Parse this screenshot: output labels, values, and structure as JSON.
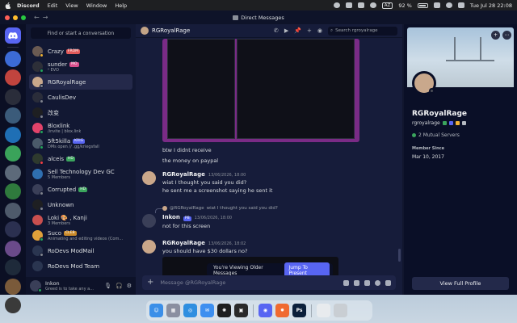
{
  "menubar": {
    "app_name": "Discord",
    "menus": [
      "Edit",
      "View",
      "Window",
      "Help"
    ],
    "input_source": "AZ",
    "battery": "92 %",
    "clock": "Tue Jul 28  22:08"
  },
  "window": {
    "title": "Direct Messages"
  },
  "rail": {
    "servers": [
      {
        "color": "#3c6bd6"
      },
      {
        "color": "#c1443e"
      },
      {
        "color": "#2a2d3a"
      },
      {
        "color": "#3b5b7a"
      },
      {
        "color": "#1f6fb5"
      },
      {
        "color": "#3aa35a"
      },
      {
        "color": "#5d6a7a"
      },
      {
        "color": "#2f7a3d"
      },
      {
        "color": "#4e5a6b"
      },
      {
        "color": "#2b3050"
      },
      {
        "color": "#6a4a8a"
      },
      {
        "color": "#1e2a3a"
      },
      {
        "color": "#7a5a3a"
      },
      {
        "color": "#3a3a3a"
      }
    ]
  },
  "sidebar": {
    "search_placeholder": "Find or start a conversation",
    "dms": [
      {
        "name": "Crazy",
        "tag": "FROM",
        "tag_color": "#e05a5a",
        "sub": "",
        "avatar": "#6a5a52",
        "status": "#f0b232"
      },
      {
        "name": "sunder",
        "tag": "MO",
        "tag_color": "#d84e8c",
        "sub": "ᵞ EVO",
        "avatar": "#2d2f38",
        "status": "#23a55a"
      },
      {
        "name": "RGRoyalRage",
        "tag": "",
        "tag_color": "",
        "sub": "",
        "avatar": "#c9a88c",
        "status": "#80848e"
      },
      {
        "name": "CaulisDev",
        "tag": "",
        "tag_color": "",
        "sub": "",
        "avatar": "#2a2d3a",
        "status": "#80848e"
      },
      {
        "name": "改变",
        "tag": "",
        "tag_color": "",
        "sub": "",
        "avatar": "#1e1f22",
        "status": "#80848e"
      },
      {
        "name": "Bloxlink",
        "tag": "",
        "tag_color": "",
        "sub": "/invite | blox.link",
        "avatar": "#e2436a",
        "status": "#23a55a"
      },
      {
        "name": "5ft5killa",
        "tag": "KRIG",
        "tag_color": "#5865f2",
        "sub": "DMs open // .gg/kriegsfall",
        "avatar": "#4a5a6a",
        "status": "#23a55a"
      },
      {
        "name": "alceis",
        "tag": "HD",
        "tag_color": "#3ba55d",
        "sub": "",
        "avatar": "#2e3a2e",
        "status": "#f23f43"
      },
      {
        "name": "Sell Technology Dev GC",
        "tag": "",
        "tag_color": "",
        "sub": "5 Members",
        "avatar": "#2f6fb0",
        "status": ""
      },
      {
        "name": "Corrupted",
        "tag": "HD",
        "tag_color": "#3ba55d",
        "sub": "",
        "avatar": "#3a3f58",
        "status": "#80848e"
      },
      {
        "name": "Unknown",
        "tag": "",
        "tag_color": "",
        "sub": "",
        "avatar": "#1e1f22",
        "status": "#80848e"
      },
      {
        "name": "Loki 🎨 , Kanji",
        "tag": "",
        "tag_color": "",
        "sub": "3 Members",
        "avatar": "#c94f4f",
        "status": ""
      },
      {
        "name": "Suco",
        "tag": "CLEB",
        "tag_color": "#c98a2a",
        "sub": "Animating and editing videos (Com...",
        "avatar": "#e0a03a",
        "status": "#23a55a"
      },
      {
        "name": "RoDevs ModMail",
        "tag": "",
        "tag_color": "",
        "sub": "",
        "avatar": "#2a3550",
        "status": "#80848e"
      },
      {
        "name": "RoDevs Mod Team",
        "tag": "",
        "tag_color": "",
        "sub": "",
        "avatar": "#2a3550",
        "status": ""
      }
    ],
    "user": {
      "name": "Inkon",
      "status": "Greed is to take any a..."
    }
  },
  "chat": {
    "recipient": "RGRoyalRage",
    "search_placeholder": "Search rgroyalrage",
    "plain_lines": [
      "btw I didnt receive",
      "the money on paypal"
    ],
    "messages": [
      {
        "author": "RGRoyalRage",
        "time": "13/06/2026, 18:00",
        "lines": [
          "wiat I thought you said you did?",
          "he sent me a screenshot saying he sent it"
        ]
      },
      {
        "author": "Inkon",
        "tag": "PB",
        "time": "13/06/2026, 18:00",
        "reply_author": "@RGRoyalRage",
        "reply_text": "wiat I thought you said you did?",
        "lines": [
          "not for this screen"
        ]
      },
      {
        "author": "RGRoyalRage",
        "time": "13/06/2026, 18:02",
        "lines": [
          "you should have $30 dollars no?"
        ]
      }
    ],
    "older_notice": "You're Viewing Older Messages",
    "jump_label": "Jump To Present",
    "composer_placeholder": "Message @RGRoyalRage"
  },
  "profile": {
    "display_name": "RGRoyalRage",
    "username": "rgroyalrage",
    "mutual": "2 Mutual Servers",
    "member_since_label": "Member Since",
    "member_since": "Mar 10, 2017",
    "full_profile_button": "View Full Profile"
  },
  "dock": {
    "apps": [
      {
        "name": "finder-icon",
        "color": "#3b8fe8",
        "glyph": "☺"
      },
      {
        "name": "launchpad-icon",
        "color": "#8a8fa0",
        "glyph": "▦"
      },
      {
        "name": "safari-icon",
        "color": "#2f8fe0",
        "glyph": "◎"
      },
      {
        "name": "mail-icon",
        "color": "#3d8ff0",
        "glyph": "✉"
      },
      {
        "name": "chatgpt-icon",
        "color": "#1e1e1e",
        "glyph": "✺"
      },
      {
        "name": "roblox-studio-icon",
        "color": "#2a2a2a",
        "glyph": "▣"
      },
      {
        "name": "discord-icon",
        "color": "#5865f2",
        "glyph": "◉"
      },
      {
        "name": "spark-icon",
        "color": "#f06a30",
        "glyph": "✹"
      },
      {
        "name": "photoshop-icon",
        "color": "#0b1f3a",
        "glyph": "Ps"
      }
    ]
  }
}
